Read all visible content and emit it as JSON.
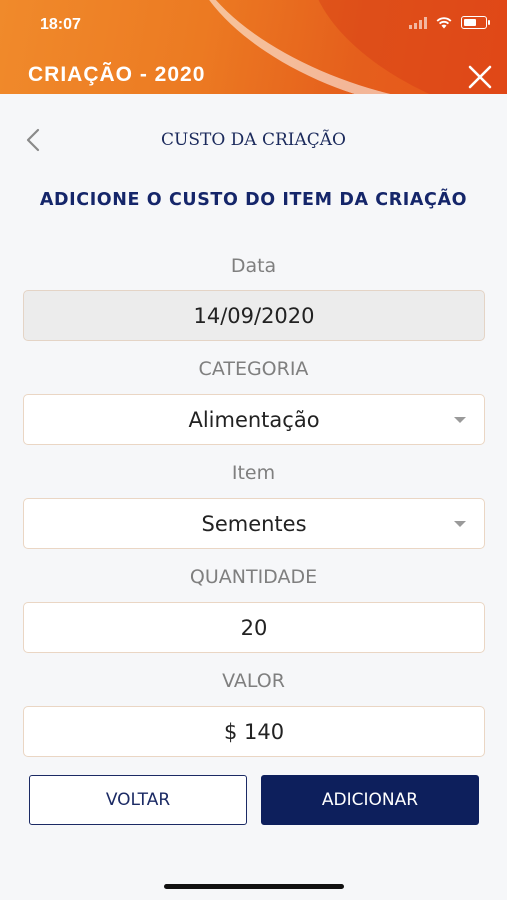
{
  "status_bar": {
    "time": "18:07"
  },
  "header": {
    "title": "CRIAÇÃO - 2020"
  },
  "nav": {
    "screen_title": "CUSTO DA CRIAÇÃO"
  },
  "form": {
    "section_title": "ADICIONE O CUSTO DO ITEM DA CRIAÇÃO",
    "date_label": "Data",
    "date_value": "14/09/2020",
    "category_label": "CATEGORIA",
    "category_value": "Alimentação",
    "item_label": "Item",
    "item_value": "Sementes",
    "quantity_label": "QUANTIDADE",
    "quantity_value": "20",
    "value_label": "VALOR",
    "value_value": "$ 140"
  },
  "buttons": {
    "back_label": "VOLTAR",
    "add_label": "ADICIONAR"
  },
  "colors": {
    "header_orange": "#ec7a22",
    "navy": "#0d1f5c",
    "label_gray": "#7f7f7f"
  },
  "icons": {
    "back": "chevron-left-icon",
    "close": "close-icon",
    "dropdown": "caret-down-icon"
  }
}
